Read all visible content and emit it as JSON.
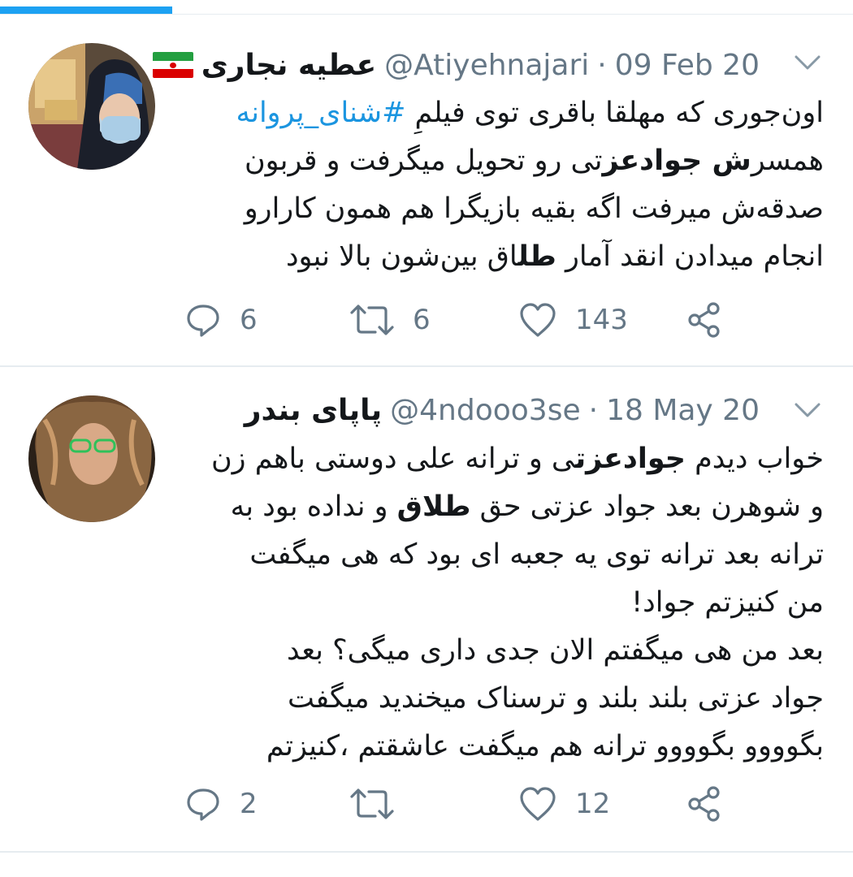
{
  "tweets": [
    {
      "display_name": "عطیه نجاری",
      "has_flag": true,
      "handle": "@Atiyehnajari",
      "separator": "·",
      "date": "09 Feb 20",
      "lines": [
        [
          {
            "t": "اون‌جوری که مهلقا باقری توی فیلمِ "
          },
          {
            "t": "#شنای_پروانه",
            "hashtag": true
          }
        ],
        [
          {
            "t": "همسر"
          },
          {
            "t": "ش جوادعز",
            "b": true
          },
          {
            "t": "تی رو تحویل میگرفت و قربون"
          }
        ],
        [
          {
            "t": "صدقه‌ش میرفت اگه بقیه بازیگرا هم همون کارارو"
          }
        ],
        [
          {
            "t": "انجام میدادن انقد آمار "
          },
          {
            "t": "طل",
            "b": true
          },
          {
            "t": "اق بین‌شون بالا نبود"
          }
        ]
      ],
      "reply_count": "6",
      "retweet_count": "6",
      "like_count": "143"
    },
    {
      "display_name": "پاپای بندر",
      "has_flag": false,
      "handle": "@4ndooo3se",
      "separator": "·",
      "date": "18 May 20",
      "lines": [
        [
          {
            "t": "خواب دیدم "
          },
          {
            "t": "جوادعزت",
            "b": true
          },
          {
            "t": "ی و ترانه علی دوستی باهم زن"
          }
        ],
        [
          {
            "t": "و شوهرن بعد جواد عزتی حق "
          },
          {
            "t": "طلاق",
            "b": true
          },
          {
            "t": " و نداده بود به"
          }
        ],
        [
          {
            "t": "ترانه بعد ترانه توی یه جعبه ای بود که هی میگفت"
          }
        ],
        [
          {
            "t": "من کنیزتم جواد!"
          }
        ],
        [
          {
            "t": "بعد من هی میگفتم الان جدی داری میگی؟ بعد"
          }
        ],
        [
          {
            "t": "جواد عزتی بلند بلند و ترسناک میخندید میگفت"
          }
        ],
        [
          {
            "t": "بگوووو بگوووو ترانه هم میگفت عاشقتم ،کنیزتم"
          }
        ]
      ],
      "reply_count": "2",
      "retweet_count": "",
      "like_count": "12"
    }
  ],
  "icons": [
    "reply-icon",
    "retweet-icon",
    "like-icon",
    "share-icon",
    "chevron-down-icon",
    "iran-flag-icon"
  ],
  "colors": {
    "accent": "#1da1f2",
    "hashtag": "#1b95e0",
    "secondary_text": "#657786",
    "divider": "#e6ecf0"
  }
}
